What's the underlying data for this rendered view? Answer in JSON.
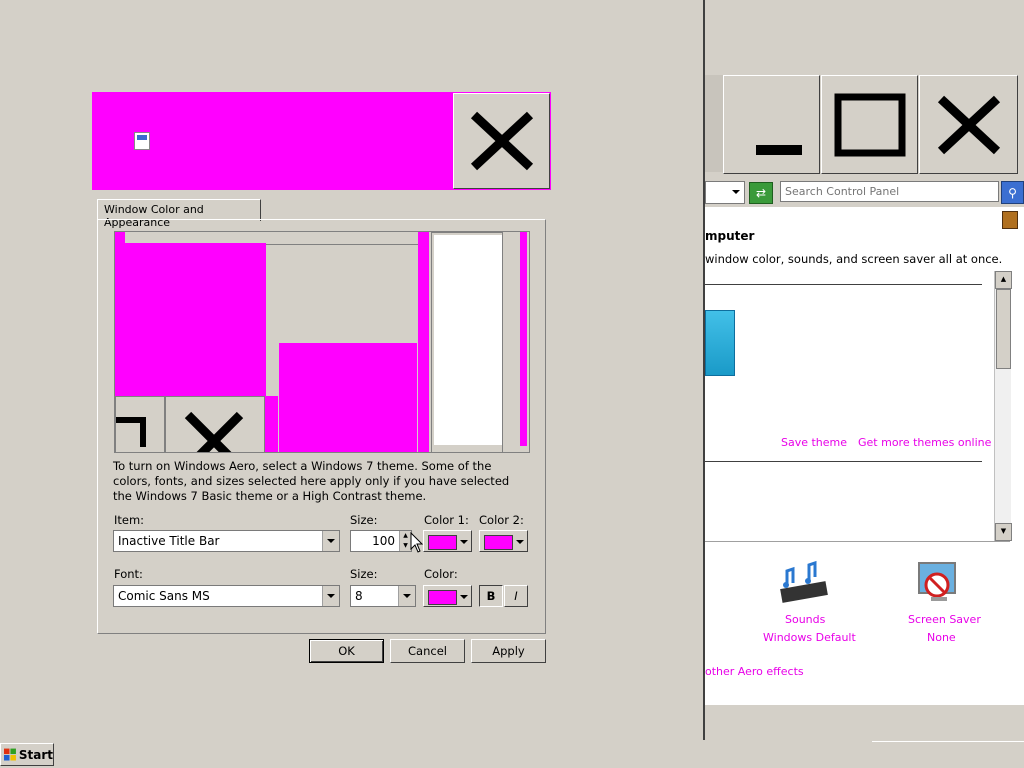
{
  "colors": {
    "accent": "#ff00ff",
    "link": "#e800e8",
    "face": "#d4d0c8"
  },
  "dialog": {
    "tab_label": "Window Color and Appearance",
    "info_text": "To turn on Windows Aero, select a Windows 7 theme.  Some of the colors, fonts, and sizes selected here apply only if you have selected the Windows 7 Basic theme or a High Contrast theme.",
    "item_label": "Item:",
    "item_value": "Inactive Title Bar",
    "size_label": "Size:",
    "size_value": "100",
    "color1_label": "Color 1:",
    "color2_label": "Color 2:",
    "font_label": "Font:",
    "font_value": "Comic Sans MS",
    "font_size_label": "Size:",
    "font_size_value": "8",
    "font_color_label": "Color:",
    "bold_label": "B",
    "italic_label": "I",
    "ok_label": "OK",
    "cancel_label": "Cancel",
    "apply_label": "Apply"
  },
  "control_panel": {
    "search_placeholder": "Search Control Panel",
    "heading_fragment": "mputer",
    "desc_fragment": "window color, sounds, and screen saver all at once.",
    "save_theme": "Save theme",
    "get_more_themes": "Get more themes online",
    "sounds_label": "Sounds",
    "sounds_value": "Windows Default",
    "screensaver_label": "Screen Saver",
    "screensaver_value": "None",
    "aero_link_fragment": "other Aero effects"
  },
  "taskbar": {
    "start_label": "Start"
  }
}
